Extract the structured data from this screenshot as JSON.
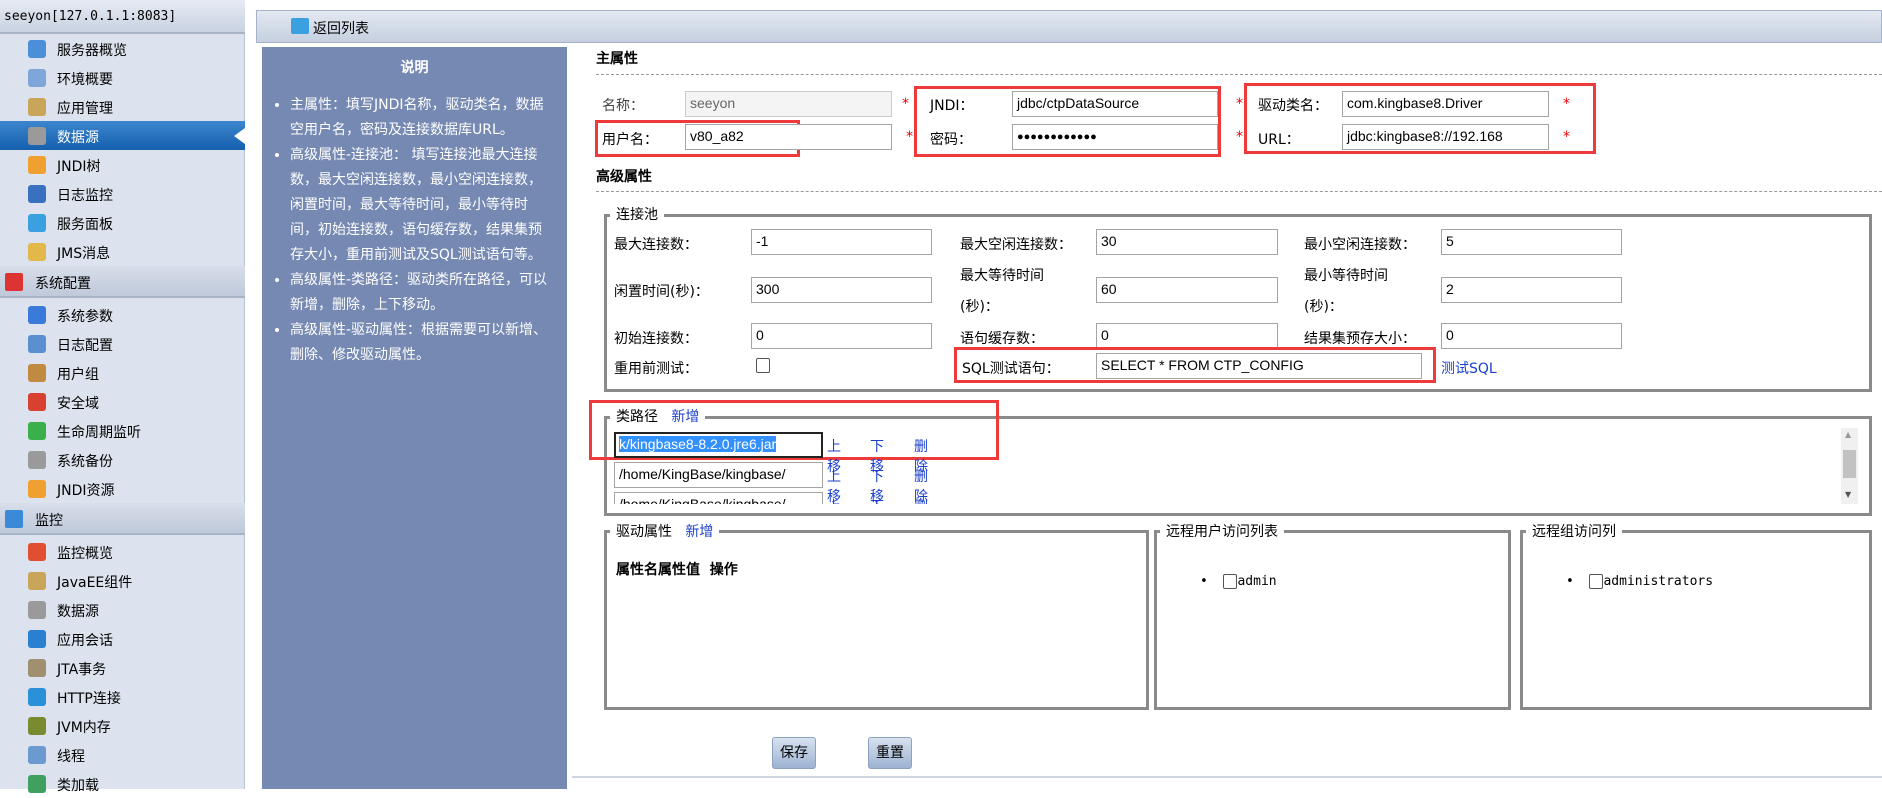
{
  "sidebar": {
    "server": "seeyon[127.0.1.1:8083]",
    "group1": [
      {
        "label": "服务器概览",
        "icon": "server-icon",
        "color": "#4a8fd8"
      },
      {
        "label": "环境概要",
        "icon": "grid-icon",
        "color": "#7fa6d8"
      },
      {
        "label": "应用管理",
        "icon": "window-icon",
        "color": "#c9a55a"
      },
      {
        "label": "数据源",
        "icon": "database-icon",
        "color": "#9a9a9a",
        "active": true
      },
      {
        "label": "JNDI树",
        "icon": "folder-tree-icon",
        "color": "#f0a030"
      },
      {
        "label": "日志监控",
        "icon": "monitor-icon",
        "color": "#3a70c0"
      },
      {
        "label": "服务面板",
        "icon": "panel-icon",
        "color": "#3aa0e0"
      },
      {
        "label": "JMS消息",
        "icon": "mail-icon",
        "color": "#e2b84a"
      }
    ],
    "section2": {
      "label": "系统配置",
      "icon": "book-icon",
      "color": "#d33"
    },
    "group2": [
      {
        "label": "系统参数",
        "icon": "hierarchy-icon",
        "color": "#3a7ad8"
      },
      {
        "label": "日志配置",
        "icon": "notebook-icon",
        "color": "#5a90d0"
      },
      {
        "label": "用户组",
        "icon": "users-icon",
        "color": "#c08a40"
      },
      {
        "label": "安全域",
        "icon": "lifebuoy-icon",
        "color": "#d84030"
      },
      {
        "label": "生命周期监听",
        "icon": "cycle-icon",
        "color": "#3ab04a"
      },
      {
        "label": "系统备份",
        "icon": "database-icon",
        "color": "#9a9a9a"
      },
      {
        "label": "JNDI资源",
        "icon": "folder-tree-icon",
        "color": "#f0a030"
      }
    ],
    "section3": {
      "label": "监控",
      "icon": "monitor-icon",
      "color": "#3a8ad8"
    },
    "group3": [
      {
        "label": "监控概览",
        "icon": "bar-chart-icon",
        "color": "#e05030"
      },
      {
        "label": "JavaEE组件",
        "icon": "window-icon",
        "color": "#c9a55a"
      },
      {
        "label": "数据源",
        "icon": "database-icon",
        "color": "#9a9a9a"
      },
      {
        "label": "应用会话",
        "icon": "globe-icon",
        "color": "#2a80d0"
      },
      {
        "label": "JTA事务",
        "icon": "gear-icon",
        "color": "#a09070"
      },
      {
        "label": "HTTP连接",
        "icon": "ie-icon",
        "color": "#2a90d8"
      },
      {
        "label": "JVM内存",
        "icon": "memory-icon",
        "color": "#7a8a30"
      },
      {
        "label": "线程",
        "icon": "cube-icon",
        "color": "#6a9ad0"
      },
      {
        "label": "类加载",
        "icon": "class-load-icon",
        "color": "#40a060"
      }
    ]
  },
  "toolbar": {
    "back_label": "返回列表"
  },
  "description": {
    "title": "说明",
    "items": [
      "主属性：填写JNDI名称，驱动类名，数据空用户名，密码及连接数据库URL。",
      "高级属性-连接池： 填写连接池最大连接数，最大空闲连接数，最小空闲连接数，闲置时间，最大等待时间，最小等待时间，初始连接数，语句缓存数，结果集预存大小，重用前测试及SQL测试语句等。",
      "高级属性-类路径：驱动类所在路径，可以新增，删除，上下移动。",
      "高级属性-驱动属性：根据需要可以新增、删除、修改驱动属性。"
    ]
  },
  "main": {
    "title": "主属性",
    "required_mark": "*",
    "name_label": "名称：",
    "name_value": "seeyon",
    "jndi_label": "JNDI：",
    "jndi_value": "jdbc/ctpDataSource",
    "driver_label": "驱动类名：",
    "driver_value": "com.kingbase8.Driver",
    "user_label": "用户名：",
    "user_value": "v80_a82",
    "password_label": "密码：",
    "password_value": "●●●●●●●●●●●●",
    "url_label": "URL：",
    "url_value": "jdbc:kingbase8://192.168"
  },
  "advanced": {
    "title": "高级属性",
    "pool": {
      "legend": "连接池",
      "max_conn_label": "最大连接数：",
      "max_conn": "-1",
      "max_idle_label": "最大空闲连接数：",
      "max_idle": "30",
      "min_idle_label": "最小空闲连接数：",
      "min_idle": "5",
      "idle_time_label": "闲置时间(秒)：",
      "idle_time": "300",
      "max_wait_label_1": "最大等待时间",
      "max_wait_label_2": "(秒)：",
      "max_wait": "60",
      "min_wait_label_1": "最小等待时间",
      "min_wait_label_2": "(秒)：",
      "min_wait": "2",
      "init_conn_label": "初始连接数：",
      "init_conn": "0",
      "stmt_cache_label": "语句缓存数：",
      "stmt_cache": "0",
      "result_prefetch_label": "结果集预存大小：",
      "result_prefetch": "0",
      "test_before_reuse_label": "重用前测试：",
      "test_before_reuse": false,
      "sql_test_label": "SQL测试语句：",
      "sql_test": "SELECT * FROM CTP_CONFIG",
      "test_sql_link": "测试SQL"
    },
    "classpath": {
      "legend": "类路径",
      "add": "新增",
      "entries": [
        "k/kingbase8-8.2.0.jre6.jar",
        "/home/KingBase/kingbase/",
        "/home/KingBase/kingbase/"
      ],
      "up": "上移",
      "down": "下移",
      "delete": "删除"
    },
    "driver_props": {
      "legend": "驱动属性",
      "add": "新增",
      "header": "属性名属性值  操作"
    },
    "remote_users": {
      "legend": "远程用户访问列表",
      "items": [
        "admin"
      ]
    },
    "remote_groups": {
      "legend": "远程组访问列",
      "items": [
        "administrators"
      ]
    }
  },
  "buttons": {
    "save": "保存",
    "reset": "重置"
  }
}
